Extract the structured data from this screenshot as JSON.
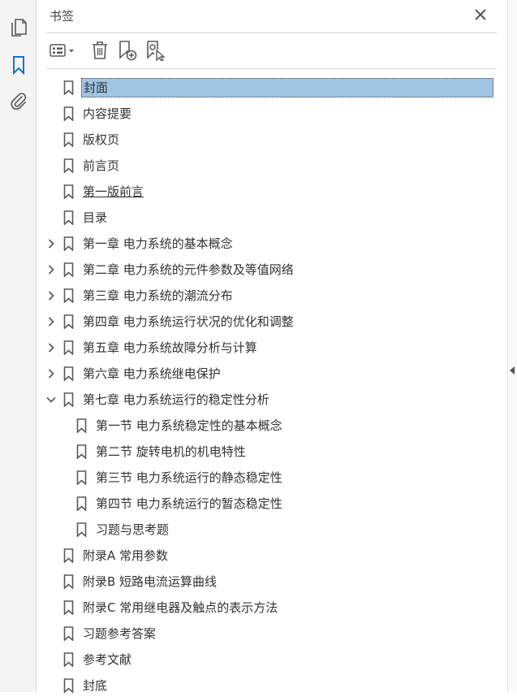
{
  "rail": {
    "items": [
      {
        "icon": "pages-icon"
      },
      {
        "icon": "bookmark-icon",
        "active": true
      },
      {
        "icon": "paperclip-icon"
      }
    ]
  },
  "panel": {
    "title": "书签",
    "toolbar": [
      {
        "icon": "options-menu-icon"
      },
      {
        "icon": "trash-icon"
      },
      {
        "icon": "new-bookmark-icon"
      },
      {
        "icon": "bookmark-search-icon"
      }
    ],
    "accent_color": "#a0c4e3",
    "icon_color": "#5a5a5a"
  },
  "bookmarks": [
    {
      "label": "封面",
      "level": 0,
      "expander": "none",
      "selected": true
    },
    {
      "label": "内容提要",
      "level": 0,
      "expander": "none"
    },
    {
      "label": "版权页",
      "level": 0,
      "expander": "none"
    },
    {
      "label": "前言页",
      "level": 0,
      "expander": "none"
    },
    {
      "label": "第一版前言",
      "level": 0,
      "expander": "none",
      "underlined": true
    },
    {
      "label": "目录",
      "level": 0,
      "expander": "none"
    },
    {
      "label": "第一章 电力系统的基本概念",
      "level": 0,
      "expander": "collapsed"
    },
    {
      "label": "第二章 电力系统的元件参数及等值网络",
      "level": 0,
      "expander": "collapsed"
    },
    {
      "label": "第三章 电力系统的潮流分布",
      "level": 0,
      "expander": "collapsed"
    },
    {
      "label": "第四章 电力系统运行状况的优化和调整",
      "level": 0,
      "expander": "collapsed"
    },
    {
      "label": "第五章 电力系统故障分析与计算",
      "level": 0,
      "expander": "collapsed"
    },
    {
      "label": "第六章 电力系统继电保护",
      "level": 0,
      "expander": "collapsed"
    },
    {
      "label": "第七章 电力系统运行的稳定性分析",
      "level": 0,
      "expander": "expanded"
    },
    {
      "label": "第一节 电力系统稳定性的基本概念",
      "level": 1,
      "expander": "none"
    },
    {
      "label": "第二节 旋转电机的机电特性",
      "level": 1,
      "expander": "none"
    },
    {
      "label": "第三节 电力系统运行的静态稳定性",
      "level": 1,
      "expander": "none"
    },
    {
      "label": "第四节 电力系统运行的暂态稳定性",
      "level": 1,
      "expander": "none"
    },
    {
      "label": "习题与思考题",
      "level": 1,
      "expander": "none"
    },
    {
      "label": "附录A 常用参数",
      "level": 0,
      "expander": "none"
    },
    {
      "label": "附录B 短路电流运算曲线",
      "level": 0,
      "expander": "none"
    },
    {
      "label": "附录C 常用继电器及触点的表示方法",
      "level": 0,
      "expander": "none"
    },
    {
      "label": "习题参考答案",
      "level": 0,
      "expander": "none"
    },
    {
      "label": "参考文献",
      "level": 0,
      "expander": "none"
    },
    {
      "label": "封底",
      "level": 0,
      "expander": "none"
    }
  ]
}
